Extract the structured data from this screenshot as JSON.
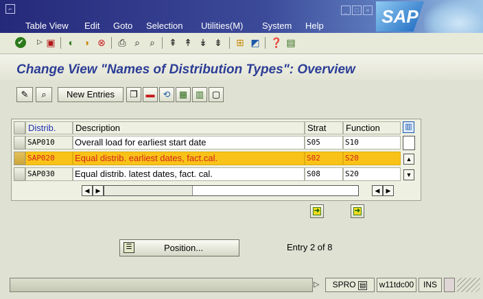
{
  "menubar": {
    "items": [
      "Table View",
      "Edit",
      "Goto",
      "Selection",
      "Utilities(M)",
      "System",
      "Help"
    ],
    "logo": "SAP"
  },
  "toolbar": {
    "icons": [
      "check-icon",
      "back-icon",
      "save-icon",
      "navigate-back-icon",
      "exit-icon",
      "cancel-icon",
      "print-icon",
      "find-icon",
      "find-next-icon",
      "first-page-icon",
      "previous-page-icon",
      "next-page-icon",
      "last-page-icon",
      "new-session-icon",
      "create-shortcut-icon",
      "help-icon",
      "layout-menu-icon"
    ]
  },
  "page": {
    "title": "Change View \"Names of Distribution Types\": Overview"
  },
  "app_toolbar": {
    "new_entries_label": "New Entries"
  },
  "table": {
    "columns": [
      "Distrib.",
      "Description",
      "Strat",
      "Function"
    ],
    "rows": [
      {
        "distrib": "SAP010",
        "description": "Overall load for earliest start date",
        "strat": "S05",
        "function": "S10",
        "selected": false
      },
      {
        "distrib": "SAP020",
        "description": "Equal distrib. earliest dates, fact.cal.",
        "strat": "S02",
        "function": "S20",
        "selected": true
      },
      {
        "distrib": "SAP030",
        "description": "Equal distrib. latest dates, fact. cal.",
        "strat": "S08",
        "function": "S20",
        "selected": false
      }
    ]
  },
  "position_button": {
    "label": "Position..."
  },
  "entry_info": "Entry 2 of 8",
  "status": {
    "transaction": "SPRO",
    "server": "w11tdc00",
    "mode": "INS"
  },
  "colors": {
    "title": "#2c3d96",
    "selected_row": "#f9c218",
    "selected_text": "#d3221f",
    "menubar": "#26297a"
  }
}
